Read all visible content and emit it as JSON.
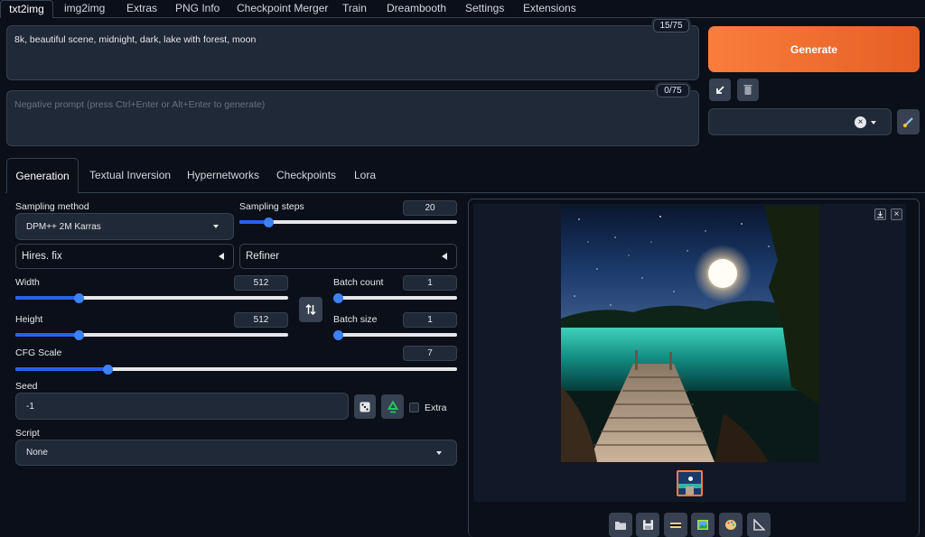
{
  "top_tabs": [
    "txt2img",
    "img2img",
    "Extras",
    "PNG Info",
    "Checkpoint Merger",
    "Train",
    "Dreambooth",
    "Settings",
    "Extensions"
  ],
  "prompt": {
    "value": "8k, beautiful scene, midnight, dark, lake with forest, moon",
    "token_count": "15/75"
  },
  "negative_prompt": {
    "placeholder": "Negative prompt (press Ctrl+Enter or Alt+Enter to generate)",
    "token_count": "0/75"
  },
  "generate_label": "Generate",
  "sub_tabs": [
    "Generation",
    "Textual Inversion",
    "Hypernetworks",
    "Checkpoints",
    "Lora"
  ],
  "sampling_method": {
    "label": "Sampling method",
    "value": "DPM++ 2M Karras"
  },
  "sampling_steps": {
    "label": "Sampling steps",
    "value": "20",
    "fraction": 0.133
  },
  "hires_fix": "Hires. fix",
  "refiner": "Refiner",
  "width": {
    "label": "Width",
    "value": "512",
    "fraction": 0.235
  },
  "height": {
    "label": "Height",
    "value": "512",
    "fraction": 0.235
  },
  "batch_count": {
    "label": "Batch count",
    "value": "1",
    "fraction": 0.0
  },
  "batch_size": {
    "label": "Batch size",
    "value": "1",
    "fraction": 0.0
  },
  "cfg_scale": {
    "label": "CFG Scale",
    "value": "7",
    "fraction": 0.21
  },
  "seed": {
    "label": "Seed",
    "value": "-1",
    "extra_label": "Extra"
  },
  "script": {
    "label": "Script",
    "value": "None"
  },
  "colors": {
    "accent": "#f97d3d",
    "slider": "#2563eb",
    "background": "#0b0f19"
  }
}
